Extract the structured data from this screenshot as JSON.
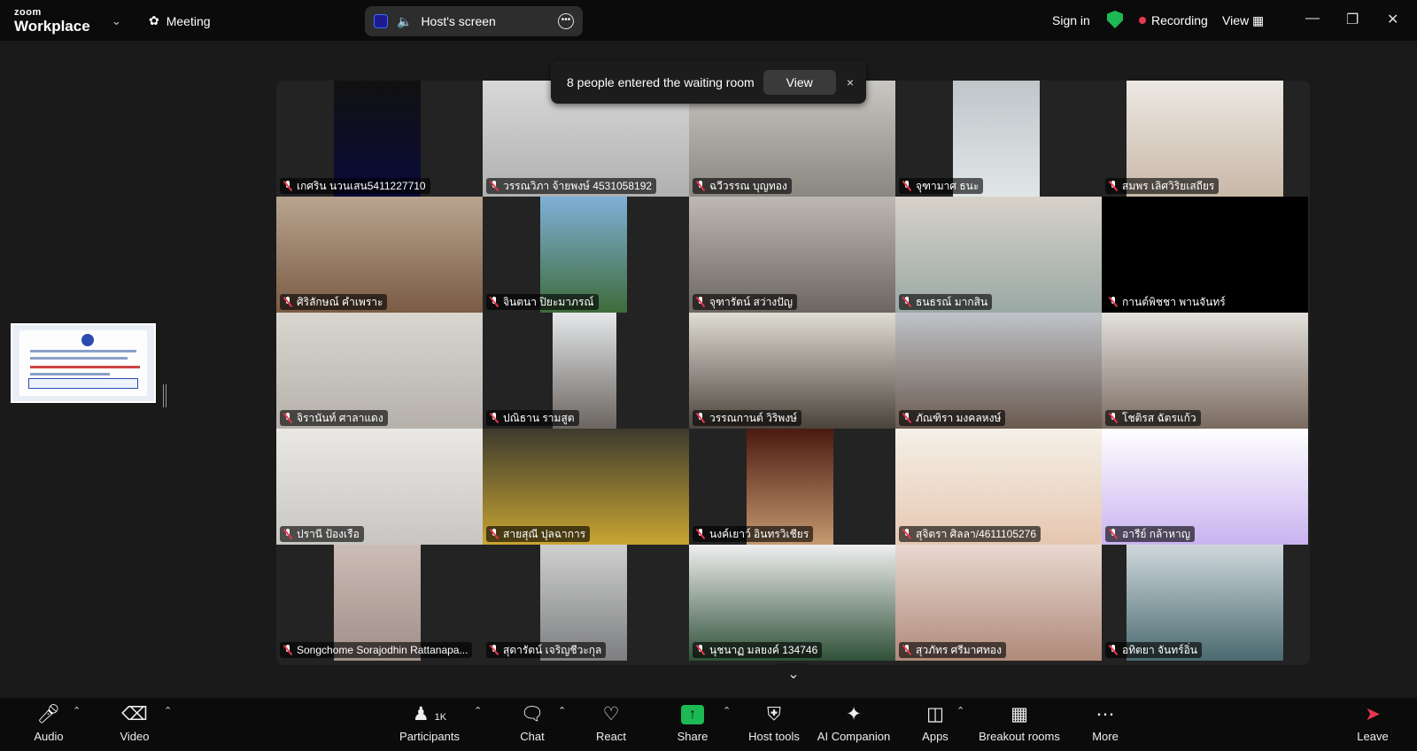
{
  "app": {
    "brand_small": "zoom",
    "brand_large": "Workplace"
  },
  "header": {
    "meeting_label": "Meeting",
    "share_pill_label": "Host's screen",
    "sign_in": "Sign in",
    "recording": "Recording",
    "view": "View"
  },
  "toast": {
    "message": "8 people entered the waiting room",
    "view_button": "View",
    "close": "×"
  },
  "participants": [
    "เกศริน  นวนเสน5411227710",
    "วรรณวิภา  จ้ายพงษ์ 4531058192",
    "ฉวีวรรณ  บุญทอง",
    "จุฑามาศ ธนะ",
    "สมพร เลิศวิริยเสถียร",
    "ศิริลักษณ์ คำเพราะ",
    "จินตนา  ปิยะมาภรณ์",
    "จุฑารัตน์  สว่างปัญ",
    "ธนธรณ์ มากสิน",
    "กานต์พิชชา พานจันทร์",
    "จิรานันท์ ศาลาแดง",
    "ปณิธาน   รามสูต",
    "วรรณกานต์ วิริพงษ์",
    "ภัณฑิรา มงคลหงษ์",
    "โชติรส ฉัตรแก้ว",
    "ปรานี ป้องเรือ",
    "สายสุณี ปุลฉาการ",
    "นงค์เยาว์ อินทรวิเชียร",
    "สุจิตรา  ศิลลา/4611105276",
    "อารีย์ กล้าหาญ",
    "Songchome Sorajodhin Rattanapa...",
    "สุดารัตน์ เจริญชีวะกุล",
    "นุชนาฏ  มลยงค์ 134746",
    "สุวภัทร ศรีมาศทอง",
    "อทิตยา จันทร์อิ่น"
  ],
  "toolbar": {
    "audio": "Audio",
    "video": "Video",
    "participants": "Participants",
    "participants_count": "1K",
    "chat": "Chat",
    "react": "React",
    "share": "Share",
    "host_tools": "Host tools",
    "ai_companion": "AI Companion",
    "apps": "Apps",
    "breakout_rooms": "Breakout rooms",
    "more": "More",
    "leave": "Leave"
  },
  "colors": {
    "recording_dot": "#e8384f",
    "share_green": "#1db954",
    "shield_green": "#1db954",
    "muted_red": "#e8384f"
  }
}
